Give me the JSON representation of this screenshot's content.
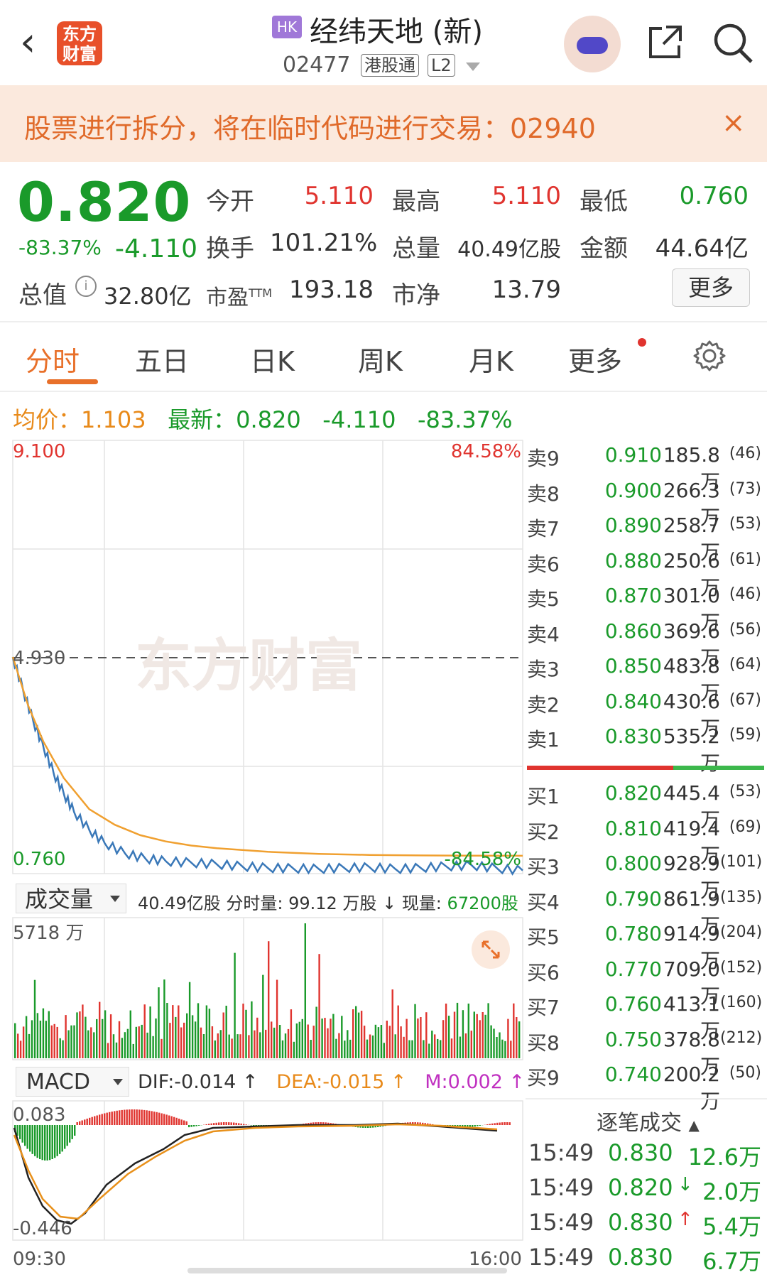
{
  "header": {
    "logo_line1": "东方",
    "logo_line2": "财富",
    "market_badge": "HK",
    "stock_name": "经纬天地 (新)",
    "stock_code": "02477",
    "tags": [
      "港股通",
      "L2"
    ]
  },
  "banner": {
    "text": "股票进行拆分，将在临时代码进行交易：02940",
    "close": "×"
  },
  "quote": {
    "price": "0.820",
    "change_pct": "-83.37%",
    "change": "-4.110",
    "market_cap_label": "总值",
    "market_cap_info": "i",
    "market_cap": "32.80亿",
    "fields": [
      {
        "label": "今开",
        "value": "5.110"
      },
      {
        "label": "最高",
        "value": "5.110"
      },
      {
        "label": "最低",
        "value": "0.760"
      },
      {
        "label": "换手",
        "value": "101.21%"
      },
      {
        "label": "总量",
        "value": "40.49亿股"
      },
      {
        "label": "金额",
        "value": "44.64亿"
      },
      {
        "label": "市盈",
        "label_sup": "TTM",
        "value": "193.18"
      },
      {
        "label": "市净",
        "value": "13.79"
      }
    ],
    "more_button": "更多"
  },
  "tabs": [
    "分时",
    "五日",
    "日K",
    "周K",
    "月K",
    "更多"
  ],
  "summary": {
    "avg_label": "均价：",
    "avg": "1.103",
    "latest_label": "最新：",
    "latest": "0.820",
    "change": "-4.110",
    "change_pct": "-83.37%"
  },
  "colors": {
    "up": "#e0342f",
    "down": "#1a9a2a",
    "accent": "#e8702a",
    "avg_line": "#f0a030",
    "price_line": "#3a78b8"
  },
  "chart_data": [
    {
      "type": "line",
      "title": "分时",
      "x_start": "09:30",
      "x_end": "16:00",
      "y_max_label": "9.100",
      "y_mid_label": "4.930",
      "y_min_label": "0.760",
      "pct_top_label": "84.58%",
      "pct_bottom_label": "-84.58%",
      "ylim": [
        0.76,
        9.1
      ],
      "prev_close": 4.93,
      "watermark": "东方财富",
      "series": [
        {
          "values_x": [
            0,
            0.02,
            0.04,
            0.06,
            0.08,
            0.1,
            0.12,
            0.15,
            0.18,
            0.22,
            0.26,
            0.3,
            0.35,
            0.4,
            0.45,
            0.5,
            0.55,
            0.6,
            0.65,
            0.7,
            0.75,
            0.8,
            0.85,
            0.9,
            0.95,
            1.0
          ],
          "values": [
            4.93,
            4.3,
            3.7,
            3.2,
            2.7,
            2.3,
            1.95,
            1.6,
            1.35,
            1.15,
            1.05,
            1.0,
            0.97,
            0.94,
            0.9,
            0.87,
            0.86,
            0.85,
            0.87,
            0.88,
            0.85,
            0.87,
            0.9,
            0.92,
            0.86,
            0.82
          ]
        },
        {
          "values_x": [
            0,
            0.03,
            0.06,
            0.1,
            0.15,
            0.2,
            0.25,
            0.3,
            0.35,
            0.4,
            0.5,
            0.6,
            0.7,
            0.8,
            0.9,
            1.0
          ],
          "values": [
            4.93,
            4.0,
            3.3,
            2.6,
            2.0,
            1.7,
            1.5,
            1.38,
            1.3,
            1.25,
            1.18,
            1.14,
            1.12,
            1.11,
            1.105,
            1.103
          ]
        }
      ]
    },
    {
      "type": "bar",
      "title": "成交量",
      "y_max_label": "5718 万",
      "ylim": [
        0,
        5718
      ],
      "total_volume": "40.49亿股",
      "tick_volume_label": "分时量:",
      "tick_volume": "99.12 万股",
      "current_label": "现量:",
      "current": "67200股"
    },
    {
      "type": "line",
      "title": "MACD",
      "y_max_label": "0.083",
      "y_min_label": "-0.446",
      "ylim": [
        -0.446,
        0.083
      ],
      "dif": "DIF:-0.014 ↑",
      "dea": "DEA:-0.015 ↑",
      "m": "M:0.002 ↑"
    }
  ],
  "order_book": {
    "asks": [
      {
        "label": "卖9",
        "price": "0.910",
        "vol": "185.8万",
        "n": "(46)"
      },
      {
        "label": "卖8",
        "price": "0.900",
        "vol": "266.3万",
        "n": "(73)"
      },
      {
        "label": "卖7",
        "price": "0.890",
        "vol": "258.7万",
        "n": "(53)"
      },
      {
        "label": "卖6",
        "price": "0.880",
        "vol": "250.6万",
        "n": "(61)"
      },
      {
        "label": "卖5",
        "price": "0.870",
        "vol": "301.0万",
        "n": "(46)"
      },
      {
        "label": "卖4",
        "price": "0.860",
        "vol": "369.6万",
        "n": "(56)"
      },
      {
        "label": "卖3",
        "price": "0.850",
        "vol": "483.8万",
        "n": "(64)"
      },
      {
        "label": "卖2",
        "price": "0.840",
        "vol": "430.6万",
        "n": "(67)"
      },
      {
        "label": "卖1",
        "price": "0.830",
        "vol": "535.2万",
        "n": "(59)"
      }
    ],
    "bids": [
      {
        "label": "买1",
        "price": "0.820",
        "vol": "445.4万",
        "n": "(53)"
      },
      {
        "label": "买2",
        "price": "0.810",
        "vol": "419.4万",
        "n": "(69)"
      },
      {
        "label": "买3",
        "price": "0.800",
        "vol": "928.9万",
        "n": "(101)"
      },
      {
        "label": "买4",
        "price": "0.790",
        "vol": "861.9万",
        "n": "(135)"
      },
      {
        "label": "买5",
        "price": "0.780",
        "vol": "914.9万",
        "n": "(204)"
      },
      {
        "label": "买6",
        "price": "0.770",
        "vol": "709.0万",
        "n": "(152)"
      },
      {
        "label": "买7",
        "price": "0.760",
        "vol": "413.1万",
        "n": "(160)"
      },
      {
        "label": "买8",
        "price": "0.750",
        "vol": "378.8万",
        "n": "(212)"
      },
      {
        "label": "买9",
        "price": "0.740",
        "vol": "200.2万",
        "n": "(50)"
      }
    ]
  },
  "trades": {
    "title": "逐笔成交",
    "rows": [
      {
        "time": "15:49",
        "price": "0.830",
        "dir": "",
        "vol": "12.6万"
      },
      {
        "time": "15:49",
        "price": "0.820",
        "dir": "↓",
        "vol": "2.0万"
      },
      {
        "time": "15:49",
        "price": "0.830",
        "dir": "↑",
        "vol": "5.4万"
      },
      {
        "time": "15:49",
        "price": "0.830",
        "dir": "",
        "vol": "6.7万"
      }
    ]
  }
}
